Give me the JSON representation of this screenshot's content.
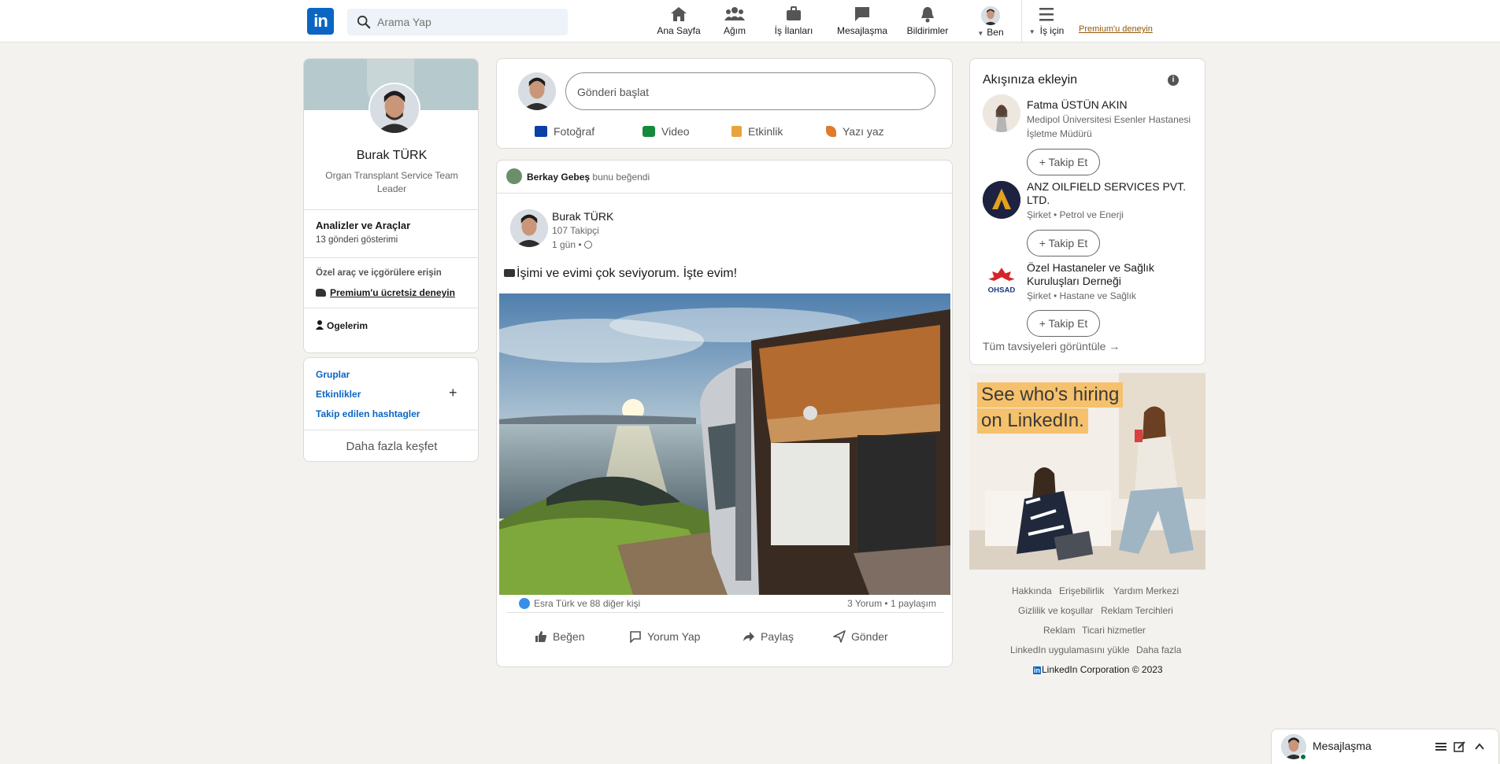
{
  "nav": {
    "logo": "in",
    "search_placeholder": "Arama Yap",
    "items": [
      {
        "label": "Ana Sayfa",
        "icon": "home-icon"
      },
      {
        "label": "Ağım",
        "icon": "network-icon"
      },
      {
        "label": "İş İlanları",
        "icon": "briefcase-icon"
      },
      {
        "label": "Mesajlaşma",
        "icon": "messaging-icon"
      },
      {
        "label": "Bildirimler",
        "icon": "bell-icon"
      },
      {
        "label": "Ben",
        "icon": "avatar"
      },
      {
        "label": "İş için",
        "icon": "grid-icon"
      }
    ],
    "premium": "Premium'u deneyin"
  },
  "profile": {
    "name": "Burak TÜRK",
    "headline": "Organ Transplant Service Team Leader",
    "analytics_title": "Analizler ve Araçlar",
    "analytics_sub": "13 gönderi gösterimi",
    "premium_hint": "Özel araç ve içgörülere erişin",
    "premium_link": "Premium'u ücretsiz deneyin",
    "saved": "Ogelerim"
  },
  "groups": {
    "items": [
      "Gruplar",
      "Etkinlikler",
      "Takip edilen hashtagler"
    ],
    "more": "Daha fazla keşfet"
  },
  "composer": {
    "placeholder": "Gönderi başlat",
    "actions": [
      "Fotoğraf",
      "Video",
      "Etkinlik",
      "Yazı yaz"
    ],
    "colors": {
      "photo": "#378fe9",
      "video": "#5f9b41",
      "event": "#c37d16",
      "article": "#e06847"
    }
  },
  "post": {
    "liked_by_name": "Berkay Gebeş",
    "liked_by_text": "bunu beğendi",
    "author": "Burak TÜRK",
    "followers": "107 Takipçi",
    "time": "1 gün •",
    "text": "İşimi ve evimi çok seviyorum. İşte evim!",
    "reactions": "Esra Türk ve 88 diğer kişi",
    "comments": "3 Yorum • 1 paylaşım",
    "actions": [
      "Beğen",
      "Yorum Yap",
      "Paylaş",
      "Gönder"
    ]
  },
  "suggestions": {
    "title": "Akışınıza ekleyin",
    "people": [
      {
        "name": "Fatma ÜSTÜN AKIN",
        "sub": "Medipol Üniversitesi Esenler Hastanesi İşletme Müdürü"
      },
      {
        "name": "ANZ OILFIELD SERVICES PVT. LTD.",
        "sub": "Şirket • Petrol ve Enerji"
      },
      {
        "name": "Özel Hastaneler ve Sağlık Kuruluşları Derneği",
        "sub": "Şirket • Hastane ve Sağlık",
        "logo_text": "OHSAD"
      }
    ],
    "follow": "+ Takip Et",
    "all": "Tüm tavsiyeleri görüntüle →"
  },
  "ad": {
    "line1": "See who's hiring",
    "line2": "on LinkedIn."
  },
  "footer": {
    "links": [
      "Hakkında",
      "Erişebilirlik",
      "Yardım Merkezi",
      "Gizlilik ve koşullar",
      "Reklam Tercihleri",
      "Reklam",
      "Ticari hizmetler",
      "LinkedIn uygulamasını yükle",
      "Daha fazla"
    ],
    "copyright": "LinkedIn Corporation © 2023",
    "copyright_logo": "in"
  },
  "messaging": {
    "label": "Mesajlaşma"
  }
}
